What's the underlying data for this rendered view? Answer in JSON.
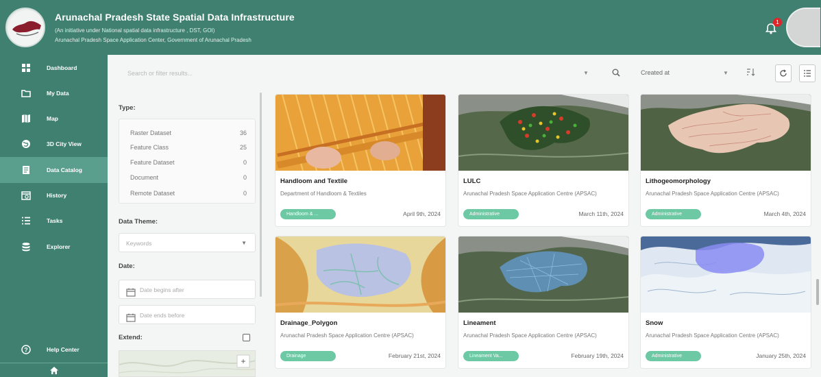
{
  "header": {
    "title": "Arunachal Pradesh State Spatial Data Infrastructure",
    "subtitle1": "(An initiative under National spatial data infrastructure , DST, GOI)",
    "subtitle2": "Arunachal Pradesh Space Application Center, Government of Arunachal Pradesh",
    "notification_count": "1"
  },
  "sidebar": {
    "items": [
      {
        "label": "Dashboard",
        "icon": "dashboard-icon"
      },
      {
        "label": "My Data",
        "icon": "folder-icon"
      },
      {
        "label": "Map",
        "icon": "map-icon"
      },
      {
        "label": "3D City View",
        "icon": "globe-icon"
      },
      {
        "label": "Data Catalog",
        "icon": "catalog-icon",
        "active": true
      },
      {
        "label": "History",
        "icon": "history-icon"
      },
      {
        "label": "Tasks",
        "icon": "tasks-icon"
      },
      {
        "label": "Explorer",
        "icon": "database-icon"
      }
    ],
    "help_label": "Help Center"
  },
  "toolbar": {
    "search_placeholder": "Search or filter results...",
    "sort_label": "Created at"
  },
  "filters": {
    "type_label": "Type:",
    "types": [
      {
        "name": "Raster Dataset",
        "count": "36"
      },
      {
        "name": "Feature Class",
        "count": "25"
      },
      {
        "name": "Feature Dataset",
        "count": "0"
      },
      {
        "name": "Document",
        "count": "0"
      },
      {
        "name": "Remote Dataset",
        "count": "0"
      }
    ],
    "theme_label": "Data Theme:",
    "keywords_placeholder": "Keywords",
    "date_label": "Date:",
    "date_after_placeholder": "Date begins after",
    "date_before_placeholder": "Date ends before",
    "extend_label": "Extend:"
  },
  "cards": [
    {
      "title": "Handloom and Textile",
      "org": "Department of Handloom & Textiles",
      "tag": "Handloom & ...",
      "date": "April 9th, 2024"
    },
    {
      "title": "LULC",
      "org": "Arunachal Pradesh Space Application Centre (APSAC)",
      "tag": "Administrative",
      "date": "March 11th, 2024"
    },
    {
      "title": "Lithogeomorphology",
      "org": "Arunachal Pradesh Space Application Centre (APSAC)",
      "tag": "Administrative",
      "date": "March 4th, 2024"
    },
    {
      "title": "Drainage_Polygon",
      "org": "Arunachal Pradesh Space Application Centre (APSAC)",
      "tag": "Drainage",
      "date": "February 21st, 2024"
    },
    {
      "title": "Lineament",
      "org": "Arunachal Pradesh Space Application Centre (APSAC)",
      "tag": "Lineament Va...",
      "date": "February 19th, 2024"
    },
    {
      "title": "Snow",
      "org": "Arunachal Pradesh Space Application Centre (APSAC)",
      "tag": "Administrative",
      "date": "January 25th, 2024"
    }
  ],
  "colors": {
    "primary": "#3f8070",
    "active_nav": "#5a9e8e",
    "chip": "#6cc9a4",
    "badge": "#e0252a"
  }
}
